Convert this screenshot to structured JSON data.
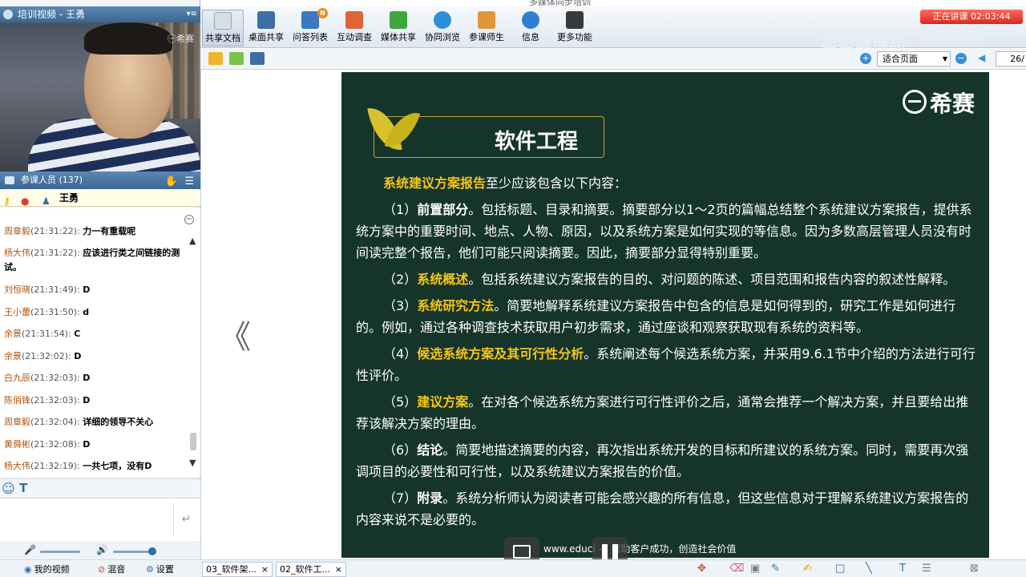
{
  "window": {
    "title": "多媒体同步培训",
    "video_title": "培训视频 - 王勇"
  },
  "video": {
    "watermark": "㊀希赛"
  },
  "participants": {
    "label": "参课人员 (137)",
    "presenter": "王勇"
  },
  "chat": [
    {
      "who": "周章毅",
      "time": "(21:31:22):",
      "text": "力一有重载呢"
    },
    {
      "who": "杨大伟",
      "time": "(21:31:22):",
      "text": "应该进行类之间链接的测试。"
    },
    {
      "who": "刘恒晓",
      "time": "(21:31:49):",
      "text": "D"
    },
    {
      "who": "王小蕾",
      "time": "(21:31:50):",
      "text": "d"
    },
    {
      "who": "余景",
      "time": "(21:31:54):",
      "text": "C"
    },
    {
      "who": "余景",
      "time": "(21:32:02):",
      "text": "D"
    },
    {
      "who": "白九辰",
      "time": "(21:32:03):",
      "text": "D"
    },
    {
      "who": "陈俏锋",
      "time": "(21:32:03):",
      "text": "D"
    },
    {
      "who": "周章毅",
      "time": "(21:32:04):",
      "text": "详细的领导不关心"
    },
    {
      "who": "黄舜彬",
      "time": "(21:32:08):",
      "text": "D"
    },
    {
      "who": "杨大伟",
      "time": "(21:32:19):",
      "text": "一共七项，没有D"
    }
  ],
  "bottom_left": {
    "my_video": "我的视频",
    "mix": "混音",
    "settings": "设置"
  },
  "toolbar": {
    "items": [
      {
        "label": "共享文档",
        "color": "#d9dde3"
      },
      {
        "label": "桌面共享",
        "color": "#3d6ea5"
      },
      {
        "label": "问答列表",
        "color": "#3a78c2",
        "badge": "N"
      },
      {
        "label": "互动调查",
        "color": "#e0633a"
      },
      {
        "label": "媒体共享",
        "color": "#3fa63f"
      },
      {
        "label": "协同浏览",
        "color": "#2e8fd8"
      },
      {
        "label": "参课师生",
        "color": "#e0963a"
      },
      {
        "label": "信息",
        "color": "#2f7fd0"
      },
      {
        "label": "更多功能",
        "color": "#3a3a3a"
      }
    ],
    "live_status": "正在讲课 02:03:44",
    "watermark": "图图最糊涂",
    "watermark2": "bilibili"
  },
  "subbar": {
    "zoom": "适合页面",
    "page": "26/"
  },
  "slide": {
    "logo": "希赛",
    "title": "软件工程",
    "intro_hl": "系统建议方案报告",
    "intro": "至少应该包含以下内容：",
    "items": [
      {
        "num": "（1）",
        "head": "前置部分",
        "hl": false,
        "text": "。包括标题、目录和摘要。摘要部分以1～2页的篇幅总结整个系统建议方案报告，提供系统方案中的重要时间、地点、人物、原因，以及系统方案是如何实现的等信息。因为多数高层管理人员没有时间读完整个报告，他们可能只阅读摘要。因此，摘要部分显得特别重要。"
      },
      {
        "num": "（2）",
        "head": "系统概述",
        "hl": true,
        "text": "。包括系统建议方案报告的目的、对问题的陈述、项目范围和报告内容的叙述性解释。"
      },
      {
        "num": "（3）",
        "head": "系统研究方法",
        "hl": true,
        "text": "。简要地解释系统建议方案报告中包含的信息是如何得到的，研究工作是如何进行的。例如，通过各种调查技术获取用户初步需求，通过座谈和观察获取现有系统的资料等。"
      },
      {
        "num": "（4）",
        "head": "候选系统方案及其可行性分析",
        "hl": true,
        "text": "。系统阐述每个候选系统方案，并采用9.6.1节中介绍的方法进行可行性评价。"
      },
      {
        "num": "（5）",
        "head": "建议方案",
        "hl": true,
        "text": "。在对各个候选系统方案进行可行性评价之后，通常会推荐一个解决方案，并且要给出推荐该解决方案的理由。"
      },
      {
        "num": "（6）",
        "head": "结论",
        "hl": false,
        "text": "。简要地描述摘要的内容，再次指出系统开发的目标和所建议的系统方案。同时，需要再次强调项目的必要性和可行性，以及系统建议方案报告的价值。"
      },
      {
        "num": "（7）",
        "head": "附录",
        "hl": false,
        "text": "。系统分析师认为阅读者可能会感兴趣的所有信息，但这些信息对于理解系统建议方案报告的内容来说不是必要的。"
      }
    ],
    "footer": "www.educi        —  帮助客户成功，创造社会价值"
  },
  "tabs": [
    {
      "label": "03_软件架..."
    },
    {
      "label": "02_软件工..."
    }
  ],
  "icons": {
    "prev_page": "《",
    "send": "↵"
  }
}
